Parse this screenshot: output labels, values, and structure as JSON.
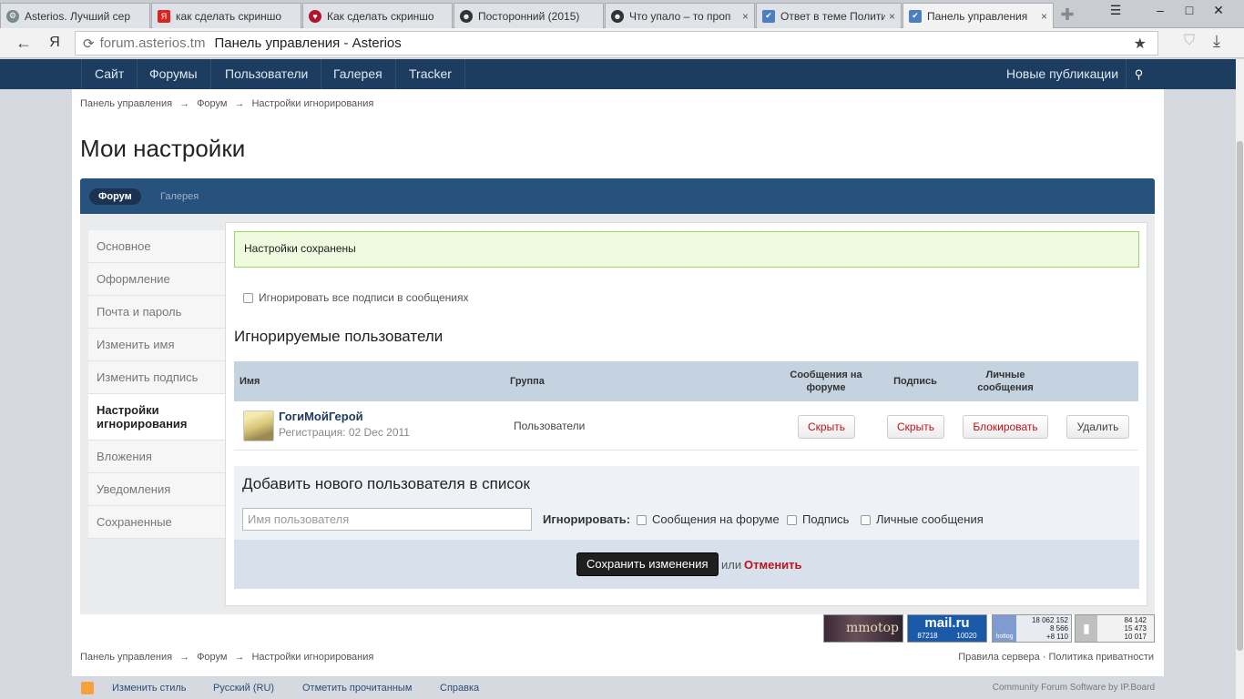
{
  "browser": {
    "tabs": [
      {
        "label": "Asterios. Лучший сер"
      },
      {
        "label": "как сделать скриншо"
      },
      {
        "label": "Как сделать скриншо"
      },
      {
        "label": "Посторонний (2015)"
      },
      {
        "label": "Что упало – то проп",
        "close": "×"
      },
      {
        "label": "Ответ в теме Полити",
        "close": "×"
      },
      {
        "label": "Панель управления",
        "close": "×"
      }
    ],
    "address_domain": "forum.asterios.tm",
    "address_title": "Панель управления - Asterios",
    "yandex_label": "Я"
  },
  "topnav": {
    "items": [
      "Сайт",
      "Форумы",
      "Пользователи",
      "Галерея",
      "Tracker"
    ],
    "new_posts": "Новые публикации"
  },
  "breadcrumb": {
    "items": [
      "Панель управления",
      "Форум",
      "Настройки игнорирования"
    ],
    "separator": "→"
  },
  "page_title": "Мои настройки",
  "subtabs": [
    "Форум",
    "Галерея"
  ],
  "sidebar": {
    "items": [
      "Основное",
      "Оформление",
      "Почта и пароль",
      "Изменить имя",
      "Изменить подпись",
      "Настройки игнорирования",
      "Вложения",
      "Уведомления",
      "Сохраненные"
    ],
    "active_index": 5
  },
  "main": {
    "success_message": "Настройки сохранены",
    "ignore_all_label": "Игнорировать все подписи в сообщениях",
    "ignored_heading": "Игнорируемые пользователи",
    "table": {
      "headers": {
        "name": "Имя",
        "group": "Группа",
        "forum_posts": "Сообщения на форуме",
        "signature": "Подпись",
        "pm": "Личные сообщения"
      },
      "rows": [
        {
          "username": "ГогиМойГерой",
          "registered": "Регистрация: 02 Dec 2011",
          "group": "Пользователи",
          "btn_posts": "Скрыть",
          "btn_signature": "Скрыть",
          "btn_pm": "Блокировать",
          "btn_delete": "Удалить"
        }
      ]
    },
    "add_user": {
      "heading": "Добавить нового пользователя в список",
      "placeholder": "Имя пользователя",
      "ignore_label": "Игнорировать:",
      "opt_posts": "Сообщения на форуме",
      "opt_signature": "Подпись",
      "opt_pm": "Личные сообщения"
    },
    "save_button": "Сохранить изменения",
    "or_text": "или",
    "cancel_link": "Отменить"
  },
  "counters": {
    "mmotop": "mmotop",
    "mailru": "mail.ru",
    "mailru_n1": "87218",
    "mailru_n2": "10020",
    "hotlog_label": "hotlog",
    "hotlog_n1": "18 062 152",
    "hotlog_n2": "8 566",
    "hotlog_n3": "+8 110",
    "li_n1": "84 142",
    "li_n2": "15 473",
    "li_n3": "10 017"
  },
  "footer": {
    "rules": "Правила сервера",
    "privacy": "Политика приватности",
    "separator": "·",
    "change_style": "Изменить стиль",
    "language": "Русский (RU)",
    "mark_read": "Отметить прочитанным",
    "help": "Справка",
    "powered": "Community Forum Software by IP.Board"
  }
}
